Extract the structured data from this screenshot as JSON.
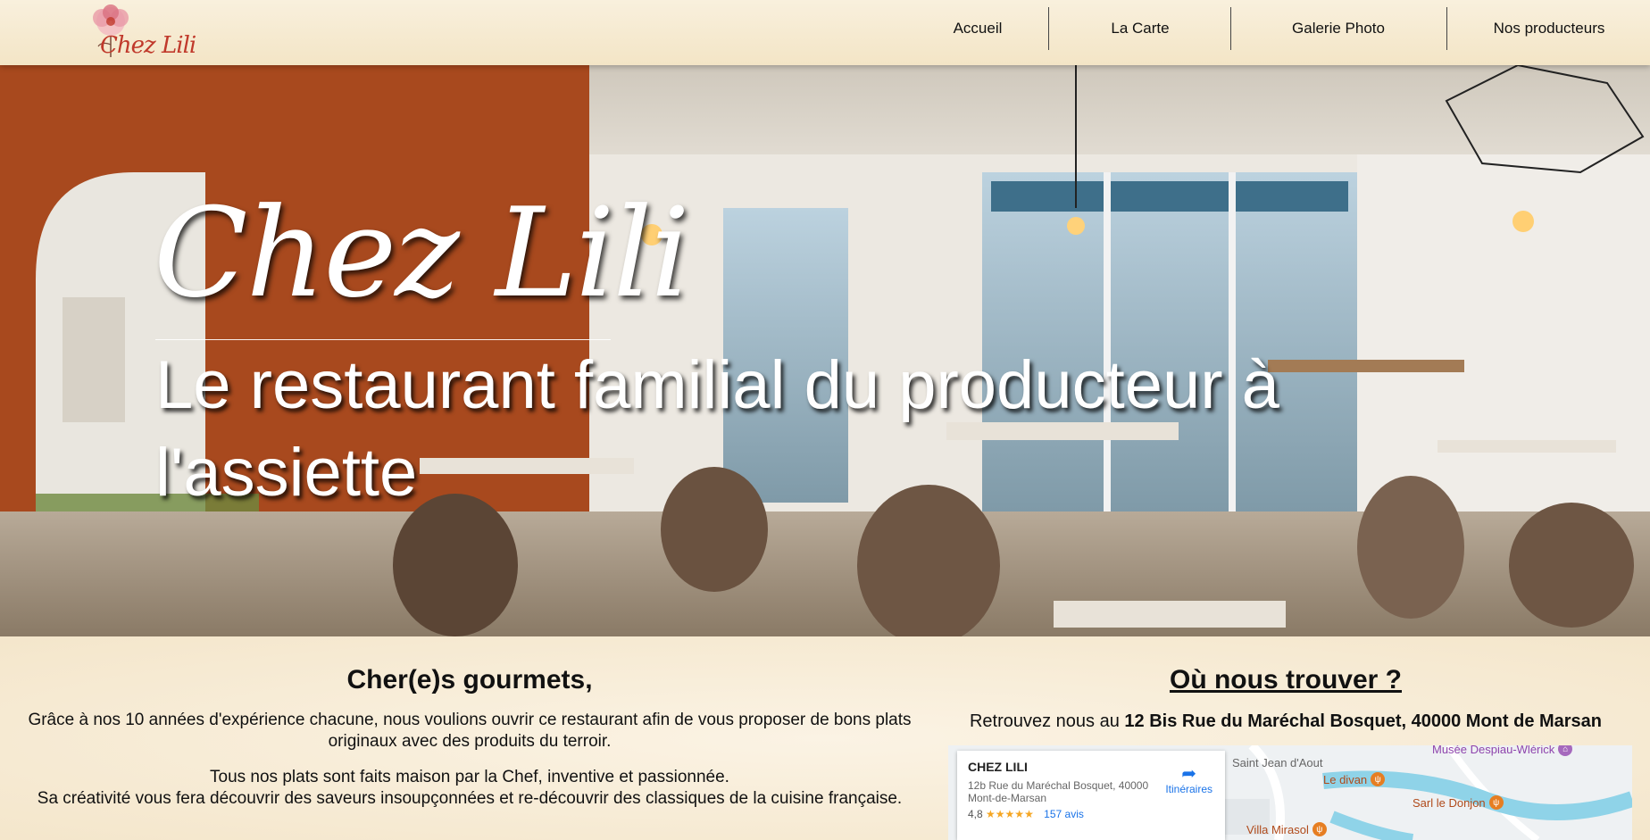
{
  "logo": {
    "text": "Chez Lili"
  },
  "nav": {
    "items": [
      "Accueil",
      "La Carte",
      "Galerie Photo",
      "Nos producteurs"
    ]
  },
  "hero": {
    "title": "Chez Lili",
    "subtitle": "Le restaurant familial du producteur à l'assiette"
  },
  "intro": {
    "greeting": "Cher(e)s gourmets,",
    "para1": "Grâce à nos 10 années d'expérience chacune, nous voulions ouvrir ce restaurant afin de vous proposer de bons plats originaux avec des produits du terroir.",
    "para2_line1": "Tous nos plats sont faits maison par la Chef, inventive et passionnée.",
    "para2_line2": "Sa créativité vous fera découvrir des saveurs insoupçonnées et re-découvrir des classiques de la cuisine française."
  },
  "location": {
    "title": "Où nous trouver ?",
    "prefix": "Retrouvez nous au",
    "address": "12 Bis Rue du Maréchal Bosquet, 40000 Mont de Marsan"
  },
  "map": {
    "name": "CHEZ LILI",
    "address": "12b Rue du Maréchal Bosquet, 40000 Mont-de-Marsan",
    "rating": "4,8",
    "stars": "★★★★★",
    "reviews": "157 avis",
    "directions": "Itinéraires",
    "pois": {
      "saint_jean": "Saint Jean d'Aout",
      "musee": "Musée Despiau-Wlérick",
      "le_divan": "Le divan",
      "sarl_donjon": "Sarl le Donjon",
      "villa_mirasol": "Villa Mirasol"
    }
  },
  "colors": {
    "background": "#f7ecd6",
    "accent": "#c0392b",
    "link": "#1a73e8"
  }
}
